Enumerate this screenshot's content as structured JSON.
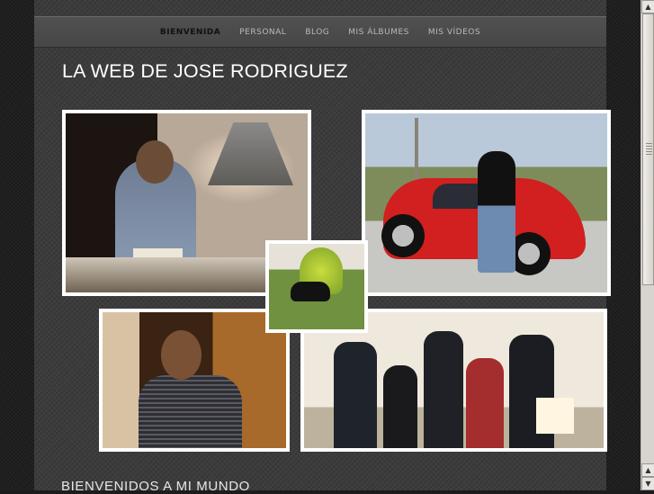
{
  "nav": {
    "items": [
      {
        "label": "BIENVENIDA",
        "active": true
      },
      {
        "label": "PERSONAL",
        "active": false
      },
      {
        "label": "BLOG",
        "active": false
      },
      {
        "label": "MIS ÁLBUMES",
        "active": false
      },
      {
        "label": "MIS VÍDEOS",
        "active": false
      }
    ]
  },
  "header": {
    "title": "LA WEB DE JOSE RODRIGUEZ"
  },
  "gallery": {
    "photos": [
      "kitchen-photo",
      "red-car-photo",
      "black-cat-photo",
      "guitar-photo",
      "family-photo"
    ]
  },
  "main": {
    "section_title": "BIENVENIDOS A MI MUNDO"
  },
  "scrollbar": {
    "up_icon": "▲",
    "down_icon": "▼",
    "position": 0.0
  },
  "colors": {
    "page_background": "#3c3c3c",
    "nav_background": "#4c4c4c",
    "nav_active": "#111111",
    "nav_text": "#b9b9b9",
    "title": "#ffffff",
    "photo_border": "#ffffff"
  }
}
